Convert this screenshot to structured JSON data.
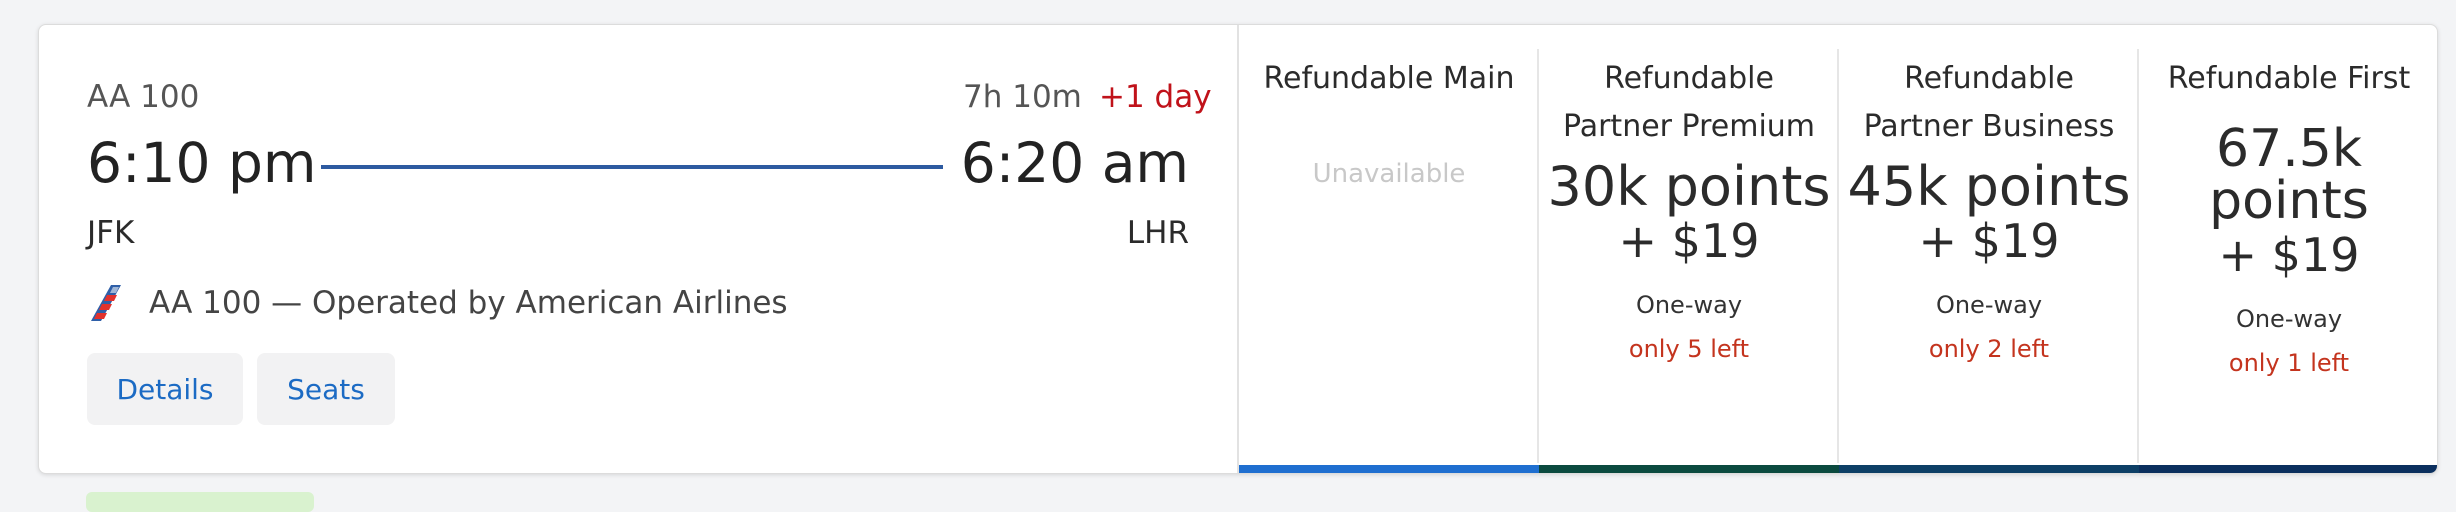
{
  "flight": {
    "number": "AA 100",
    "duration": "7h 10m",
    "day_offset": "+1 day",
    "departure_time": "6:10 pm",
    "arrival_time": "6:20 am",
    "origin": "JFK",
    "destination": "LHR",
    "operated_by": "AA 100 — Operated by American Airlines",
    "airline_logo_icon": "american-airlines-logo"
  },
  "actions": {
    "details_label": "Details",
    "seats_label": "Seats"
  },
  "fares": [
    {
      "name": "Refundable Main",
      "available": false,
      "unavailable_label": "Unavailable",
      "bar_color": "#1f6fd0"
    },
    {
      "name": "Refundable Partner Premium",
      "available": true,
      "points": "30k points",
      "cash": "+ $19",
      "trip": "One-way",
      "seats_left": "only 5 left",
      "bar_color": "#0b4a3f"
    },
    {
      "name": "Refundable Partner Business",
      "available": true,
      "points": "45k points",
      "cash": "+ $19",
      "trip": "One-way",
      "seats_left": "only 2 left",
      "bar_color": "#0d3f66"
    },
    {
      "name": "Refundable First",
      "available": true,
      "points": "67.5k points",
      "cash": "+ $19",
      "trip": "One-way",
      "seats_left": "only 1 left",
      "bar_color": "#0b2f5e"
    }
  ],
  "colors": {
    "accent_link": "#1c6bc4",
    "route_line": "#2d5aa0",
    "day_offset": "#c0121a",
    "seats_left": "#c4341e"
  }
}
